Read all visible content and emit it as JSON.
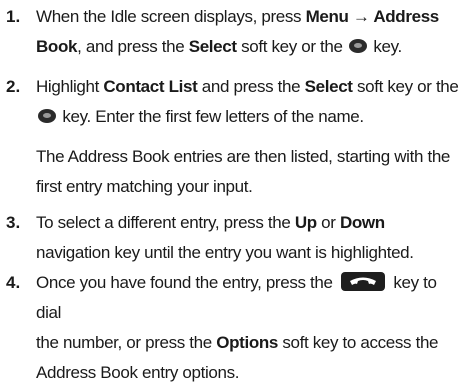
{
  "steps": [
    {
      "number": "1.",
      "segments": [
        {
          "t": "When the Idle screen displays, press "
        },
        {
          "t": "Menu",
          "b": true
        },
        {
          "t": " → ",
          "b": true
        },
        {
          "t": "Address",
          "b": true
        },
        {
          "br": true
        },
        {
          "t": "Book",
          "b": true
        },
        {
          "t": ", and press the "
        },
        {
          "t": "Select",
          "b": true
        },
        {
          "t": " soft key or the "
        },
        {
          "icon": "select-key-icon"
        },
        {
          "t": " key."
        }
      ]
    },
    {
      "number": "2.",
      "segments": [
        {
          "t": "Highlight "
        },
        {
          "t": "Contact List",
          "b": true
        },
        {
          "t": " and press the "
        },
        {
          "t": "Select",
          "b": true
        },
        {
          "t": " soft key or the"
        },
        {
          "br": true
        },
        {
          "icon": "select-key-icon"
        },
        {
          "t": " key. Enter the first few letters of the name."
        }
      ],
      "note": "The Address Book entries are then listed, starting with the first entry matching your input."
    },
    {
      "number": "3.",
      "segments": [
        {
          "t": "To select a different entry, press the "
        },
        {
          "t": "Up",
          "b": true
        },
        {
          "t": " or "
        },
        {
          "t": "Down",
          "b": true
        },
        {
          "br": true
        },
        {
          "t": "navigation key until the entry you want is highlighted."
        }
      ]
    },
    {
      "number": "4.",
      "segments": [
        {
          "t": "Once you have found the entry, press the "
        },
        {
          "icon": "send-key-icon"
        },
        {
          "t": " key to dial"
        },
        {
          "br": true
        },
        {
          "t": "the number, or press the "
        },
        {
          "t": "Options",
          "b": true
        },
        {
          "t": " soft key to access the"
        },
        {
          "br": true
        },
        {
          "t": "Address Book entry options."
        }
      ]
    }
  ]
}
